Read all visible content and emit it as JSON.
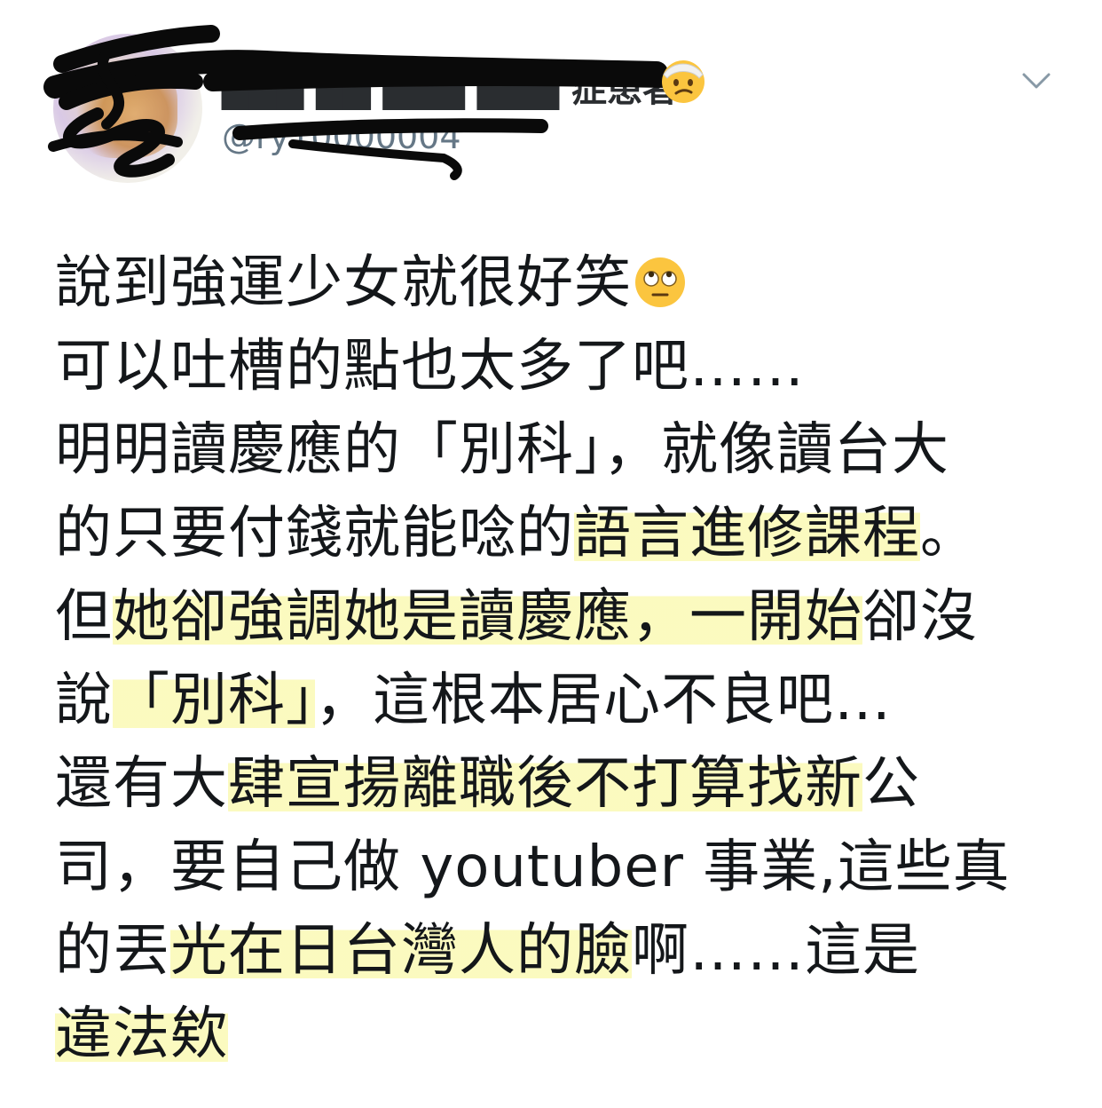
{
  "user": {
    "display_name": "███ ██ ███ ███ 症患者",
    "handle": "@ry10000004"
  },
  "tweet": {
    "lines": [
      {
        "parts": [
          {
            "t": "說到強運少女就很好笑",
            "hl": false
          }
        ]
      },
      {
        "parts": [
          {
            "t": "可以吐槽的點也太多了吧……",
            "hl": false
          }
        ]
      },
      {
        "parts": [
          {
            "t": "明明讀慶應的「別科」，就像讀台大",
            "hl": false
          }
        ]
      },
      {
        "parts": [
          {
            "t": "的只要付錢就能唸的",
            "hl": false
          },
          {
            "t": "語言進修課程",
            "hl": true
          },
          {
            "t": "。",
            "hl": false
          }
        ]
      },
      {
        "parts": [
          {
            "t": "但",
            "hl": false
          },
          {
            "t": "她卻強調她是讀慶應，一開始",
            "hl": true
          },
          {
            "t": "卻沒",
            "hl": false
          }
        ]
      },
      {
        "parts": [
          {
            "t": "說",
            "hl": false
          },
          {
            "t": "「別科」",
            "hl": true
          },
          {
            "t": "，這根本居心不良吧…",
            "hl": false
          }
        ]
      },
      {
        "parts": [
          {
            "t": "還有大",
            "hl": false
          },
          {
            "t": "肆宣揚離職後不打算找新",
            "hl": true
          },
          {
            "t": "公",
            "hl": false
          }
        ]
      },
      {
        "parts": [
          {
            "t": "司，要自己做 youtuber 事業,這些真",
            "hl": false
          }
        ]
      },
      {
        "parts": [
          {
            "t": "的丟",
            "hl": false
          },
          {
            "t": "光在日台灣人的臉",
            "hl": true
          },
          {
            "t": "啊……這是",
            "hl": false
          }
        ]
      },
      {
        "parts": [
          {
            "t": "違法欸",
            "hl": true
          }
        ]
      }
    ],
    "emoji_after_line1": "face-with-rolling-eyes"
  },
  "colors": {
    "text": "#14171a",
    "secondary": "#657786",
    "highlight": "#faf8aa",
    "scribble": "#0a0a0a"
  }
}
